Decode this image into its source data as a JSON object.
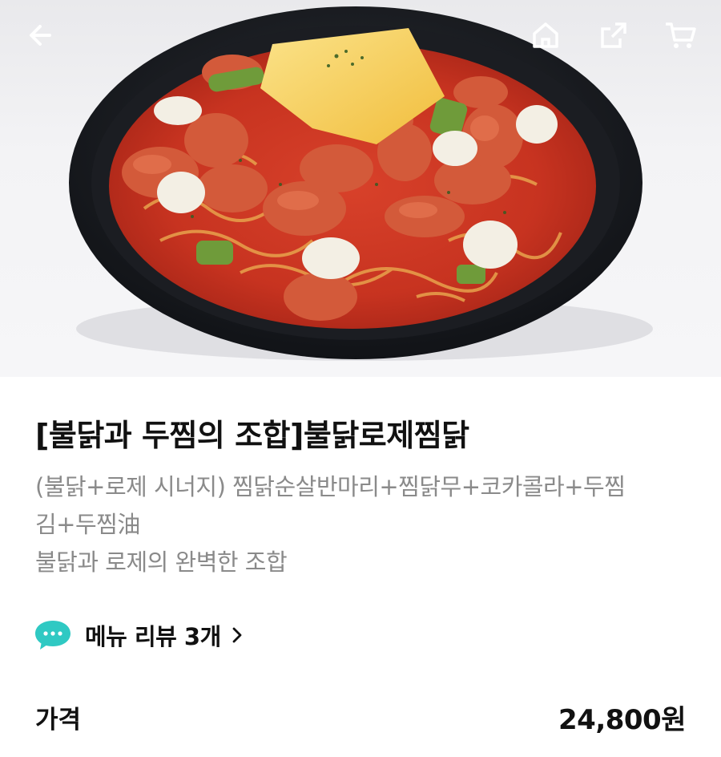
{
  "header": {
    "back_icon": "arrow-left-icon",
    "home_icon": "home-icon",
    "share_icon": "share-icon",
    "cart_icon": "cart-icon"
  },
  "product": {
    "title": "[불닭과 두찜의 조합]불닭로제찜닭",
    "description_lines": [
      "(불닭+로제 시너지) 찜닭순살반마리+찜닭무+코카콜라+두찜",
      "김+두찜油",
      "불닭과 로제의 완벽한 조합"
    ]
  },
  "review": {
    "icon": "speech-bubble-icon",
    "label": "메뉴 리뷰 3개",
    "accent_color": "#2fc9c3"
  },
  "price": {
    "label": "가격",
    "value": "24,800원"
  }
}
